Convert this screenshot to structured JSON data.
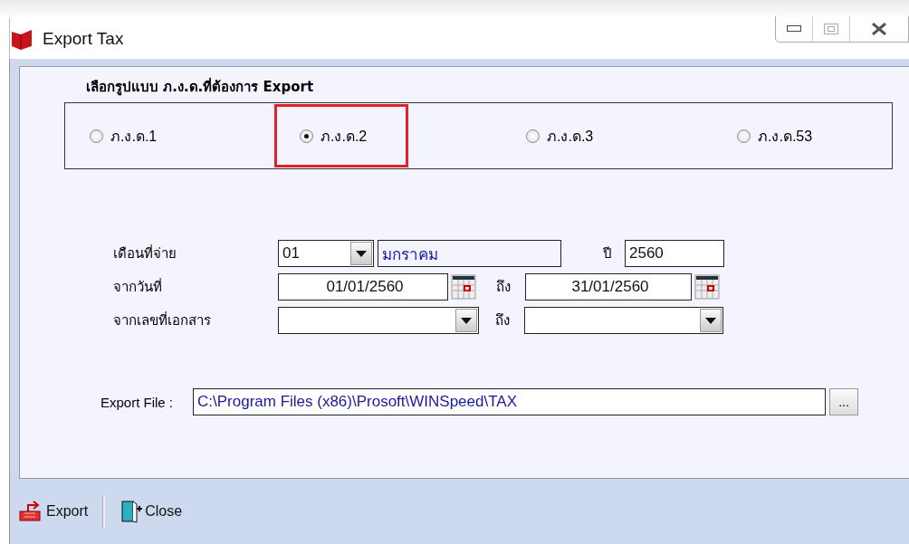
{
  "window": {
    "title": "Export Tax"
  },
  "format_group": {
    "heading": "เลือกรูปแบบ ภ.ง.ด.ที่ต้องการ Export",
    "options": [
      {
        "label": "ภ.ง.ด.1",
        "selected": false,
        "highlighted": false
      },
      {
        "label": "ภ.ง.ด.2",
        "selected": true,
        "highlighted": true
      },
      {
        "label": "ภ.ง.ด.3",
        "selected": false,
        "highlighted": false
      },
      {
        "label": "ภ.ง.ด.53",
        "selected": false,
        "highlighted": false
      }
    ]
  },
  "pay_month": {
    "label": "เดือนที่จ่าย",
    "month": "01",
    "month_name": "มกราคม",
    "year_label": "ปี",
    "year": "2560"
  },
  "date_range": {
    "label": "จากวันที่",
    "from": "01/01/2560",
    "to_label": "ถึง",
    "to": "31/01/2560"
  },
  "doc_range": {
    "label": "จากเลขที่เอกสาร",
    "to_label": "ถึง"
  },
  "export_file": {
    "label": "Export File :",
    "path": "C:\\Program Files (x86)\\Prosoft\\WINSpeed\\TAX",
    "browse": "..."
  },
  "toolbar": [
    {
      "kind": "export",
      "label": "Export"
    },
    {
      "kind": "close",
      "label": "Close"
    }
  ]
}
